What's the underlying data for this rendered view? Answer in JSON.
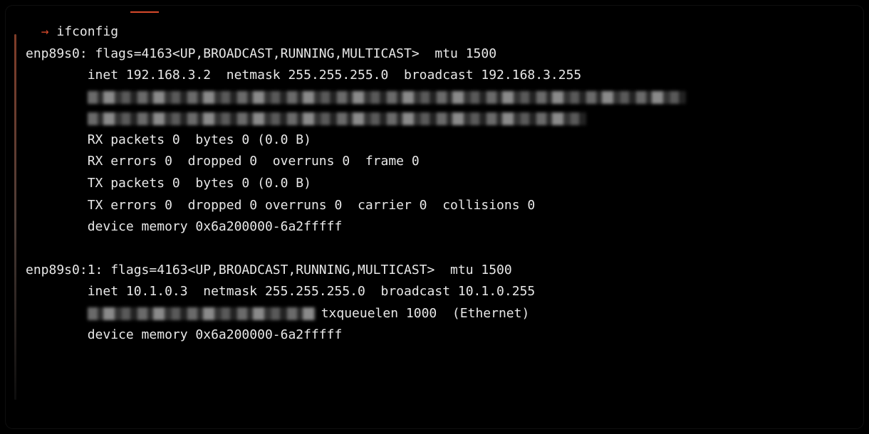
{
  "prompt": {
    "arrow": "→",
    "command": "ifconfig"
  },
  "interfaces": [
    {
      "name": "enp89s0",
      "header": "enp89s0: flags=4163<UP,BROADCAST,RUNNING,MULTICAST>  mtu 1500",
      "inet": "        inet 192.168.3.2  netmask 255.255.255.0  broadcast 192.168.3.255",
      "rx_packets": "        RX packets 0  bytes 0 (0.0 B)",
      "rx_errors": "        RX errors 0  dropped 0  overruns 0  frame 0",
      "tx_packets": "        TX packets 0  bytes 0 (0.0 B)",
      "tx_errors": "        TX errors 0  dropped 0 overruns 0  carrier 0  collisions 0",
      "devmem": "        device memory 0x6a200000-6a2fffff"
    },
    {
      "name": "enp89s0:1",
      "header": "enp89s0:1: flags=4163<UP,BROADCAST,RUNNING,MULTICAST>  mtu 1500",
      "inet": "        inet 10.1.0.3  netmask 255.255.255.0  broadcast 10.1.0.255",
      "txq_tail": "txqueuelen 1000  (Ethernet)",
      "devmem": "        device memory 0x6a200000-6a2fffff"
    }
  ]
}
